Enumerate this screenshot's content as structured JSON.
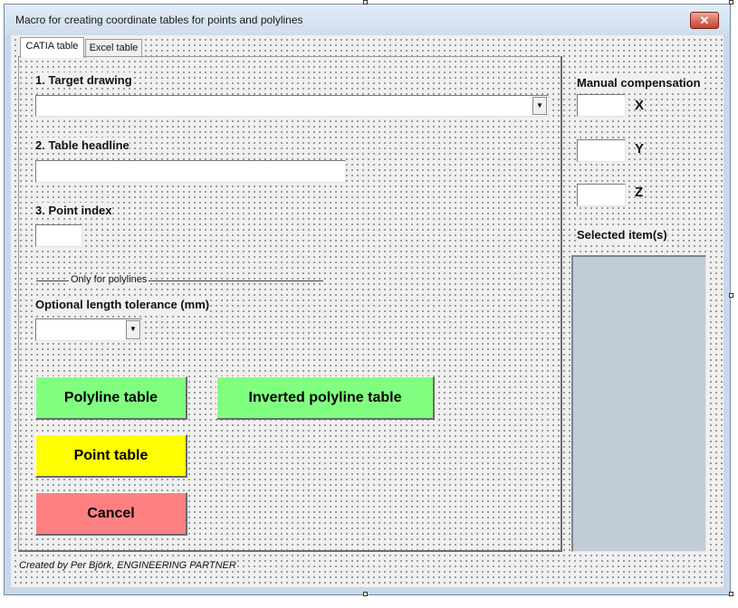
{
  "window": {
    "title": "Macro for creating coordinate tables for points and polylines",
    "close_glyph": "✕"
  },
  "tabs": [
    {
      "label": "CATIA table",
      "active": true
    },
    {
      "label": "Excel table",
      "active": false
    }
  ],
  "catia_tab": {
    "target_drawing": {
      "label": "1. Target drawing",
      "value": ""
    },
    "table_headline": {
      "label": "2. Table headline",
      "value": ""
    },
    "point_index": {
      "label": "3. Point index",
      "value": ""
    },
    "polylines_separator": "Only for polylines",
    "length_tolerance": {
      "label": "Optional length tolerance (mm)",
      "value": ""
    },
    "buttons": {
      "polyline_table": "Polyline table",
      "inverted_polyline_table": "Inverted polyline table",
      "point_table": "Point table",
      "cancel": "Cancel"
    }
  },
  "side_panel": {
    "manual_compensation_label": "Manual compensation",
    "x_label": "X",
    "y_label": "Y",
    "z_label": "Z",
    "x_value": "",
    "y_value": "",
    "z_value": "",
    "selected_items_label": "Selected item(s)"
  },
  "footer": {
    "credit": "Created by Per Björk, ENGINEERING PARTNER"
  },
  "colors": {
    "polyline_buttons": "#80ff80",
    "point_button": "#ffff00",
    "cancel_button": "#ff8080",
    "selection_list": "#c0ccd8"
  },
  "icons": {
    "combo_arrow": "dropdown-arrow-icon",
    "close": "close-icon"
  }
}
